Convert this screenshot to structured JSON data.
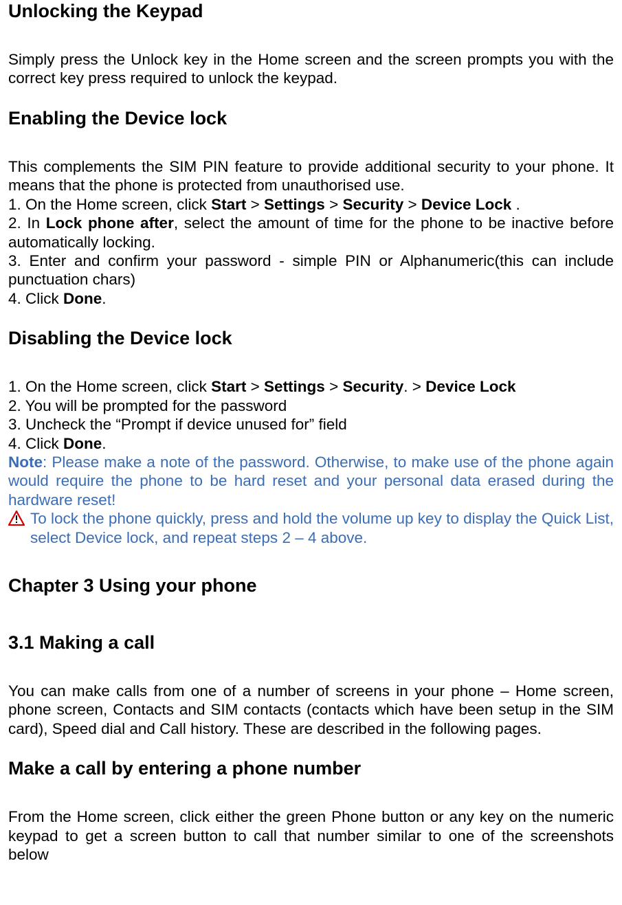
{
  "section1": {
    "title": "Unlocking the Keypad",
    "body": "Simply press the Unlock key in the Home screen and the screen prompts you with the correct key press required to unlock the keypad."
  },
  "section2": {
    "title": "Enabling the Device lock",
    "intro": "This complements the SIM PIN feature to provide additional security to your phone. It means that the phone is protected from unauthorised use.",
    "step1_a": "1. On the Home screen, click ",
    "step1_b": "Start",
    "step1_c": " > ",
    "step1_d": "Settings",
    "step1_e": " > ",
    "step1_f": "Security",
    "step1_g": " > ",
    "step1_h": "Device Lock",
    "step1_i": " .",
    "step2_a": "2. In ",
    "step2_b": "Lock phone after",
    "step2_c": ", select the amount of time for the phone to be inactive before automatically locking.",
    "step3": "3. Enter and confirm your password - simple PIN or Alphanumeric(this can include punctuation chars)",
    "step4_a": "4. Click ",
    "step4_b": "Done",
    "step4_c": "."
  },
  "section3": {
    "title": "Disabling the Device lock",
    "step1_a": "1. On the Home screen, click ",
    "step1_b": "Start",
    "step1_c": " > ",
    "step1_d": "Settings",
    "step1_e": " > ",
    "step1_f": "Security",
    "step1_g": ". > ",
    "step1_h": "Device Lock",
    "step2": "2. You will be prompted for the password",
    "step3": "3. Uncheck the “Prompt if device unused for” field",
    "step4_a": "4. Click ",
    "step4_b": "Done",
    "step4_c": ".",
    "note_a": "Note",
    "note_b": ": Please make a note of the password. Otherwise, to make use of the phone again would require the phone to be hard reset and your personal data erased during the hardware reset!",
    "warn": " To lock the phone quickly, press and hold the volume up key to display the Quick List, select Device lock, and repeat steps 2 – 4 above."
  },
  "chapter": {
    "title": "Chapter 3 Using your phone"
  },
  "section4": {
    "title": "3.1 Making a call",
    "body": "You can make calls from one of a number of screens in your phone – Home screen, phone screen, Contacts and SIM contacts (contacts which have been setup in the SIM card), Speed dial and Call history. These are described in the following pages."
  },
  "section5": {
    "title": "Make a call by entering a phone number",
    "body": "From the Home screen, click either the green Phone button or any key on the numeric keypad to get a screen button to call that number similar to one of the screenshots below"
  }
}
